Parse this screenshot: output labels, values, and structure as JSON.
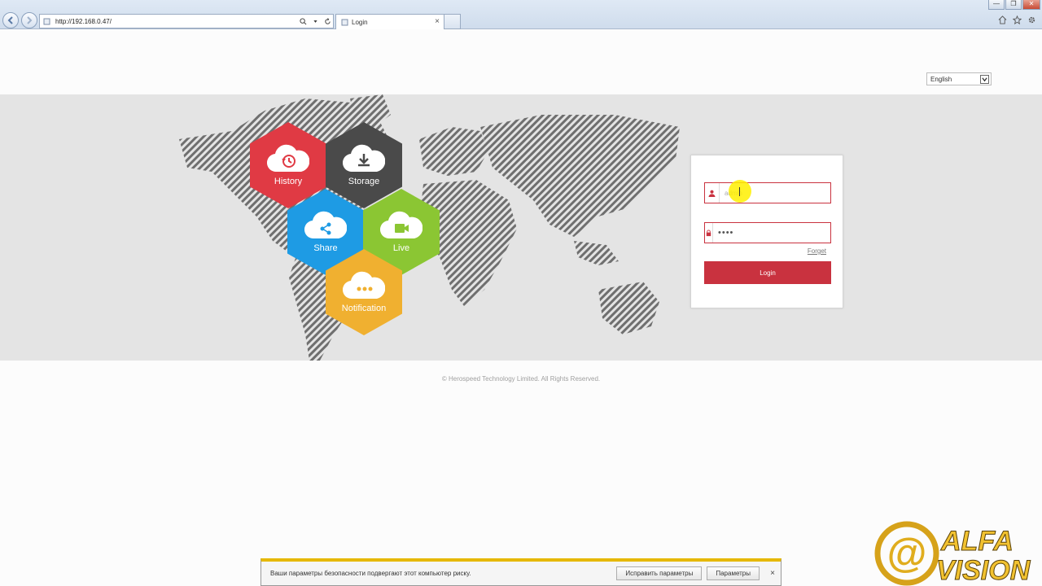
{
  "browser": {
    "url": "http://192.168.0.47/",
    "tab_title": "Login",
    "window_buttons": {
      "minimize": "—",
      "restore": "❐",
      "close": "✕"
    }
  },
  "language": {
    "selected": "English"
  },
  "features": [
    {
      "key": "history",
      "label": "History",
      "color": "#e03a44",
      "icon": "history-icon"
    },
    {
      "key": "storage",
      "label": "Storage",
      "color": "#4a4a4a",
      "icon": "download-icon"
    },
    {
      "key": "share",
      "label": "Share",
      "color": "#1e9be4",
      "icon": "share-icon"
    },
    {
      "key": "live",
      "label": "Live",
      "color": "#8bc633",
      "icon": "video-camera-icon"
    },
    {
      "key": "notification",
      "label": "Notification",
      "color": "#f0b030",
      "icon": "chat-dots-icon"
    }
  ],
  "login": {
    "username_value": "admin",
    "password_value": "••••",
    "forget_label": "Forget",
    "button_label": "Login",
    "accent_color": "#c9323f"
  },
  "footer": {
    "copyright": "©  Herospeed Technology Limited.  All Rights Reserved."
  },
  "ie_notification": {
    "message": "Ваши параметры безопасности подвергают этот компьютер риску.",
    "fix_button": "Исправить параметры",
    "settings_button": "Параметры",
    "close": "×"
  },
  "watermark": {
    "text_line1": "ALFA",
    "text_line2": "VISION"
  }
}
